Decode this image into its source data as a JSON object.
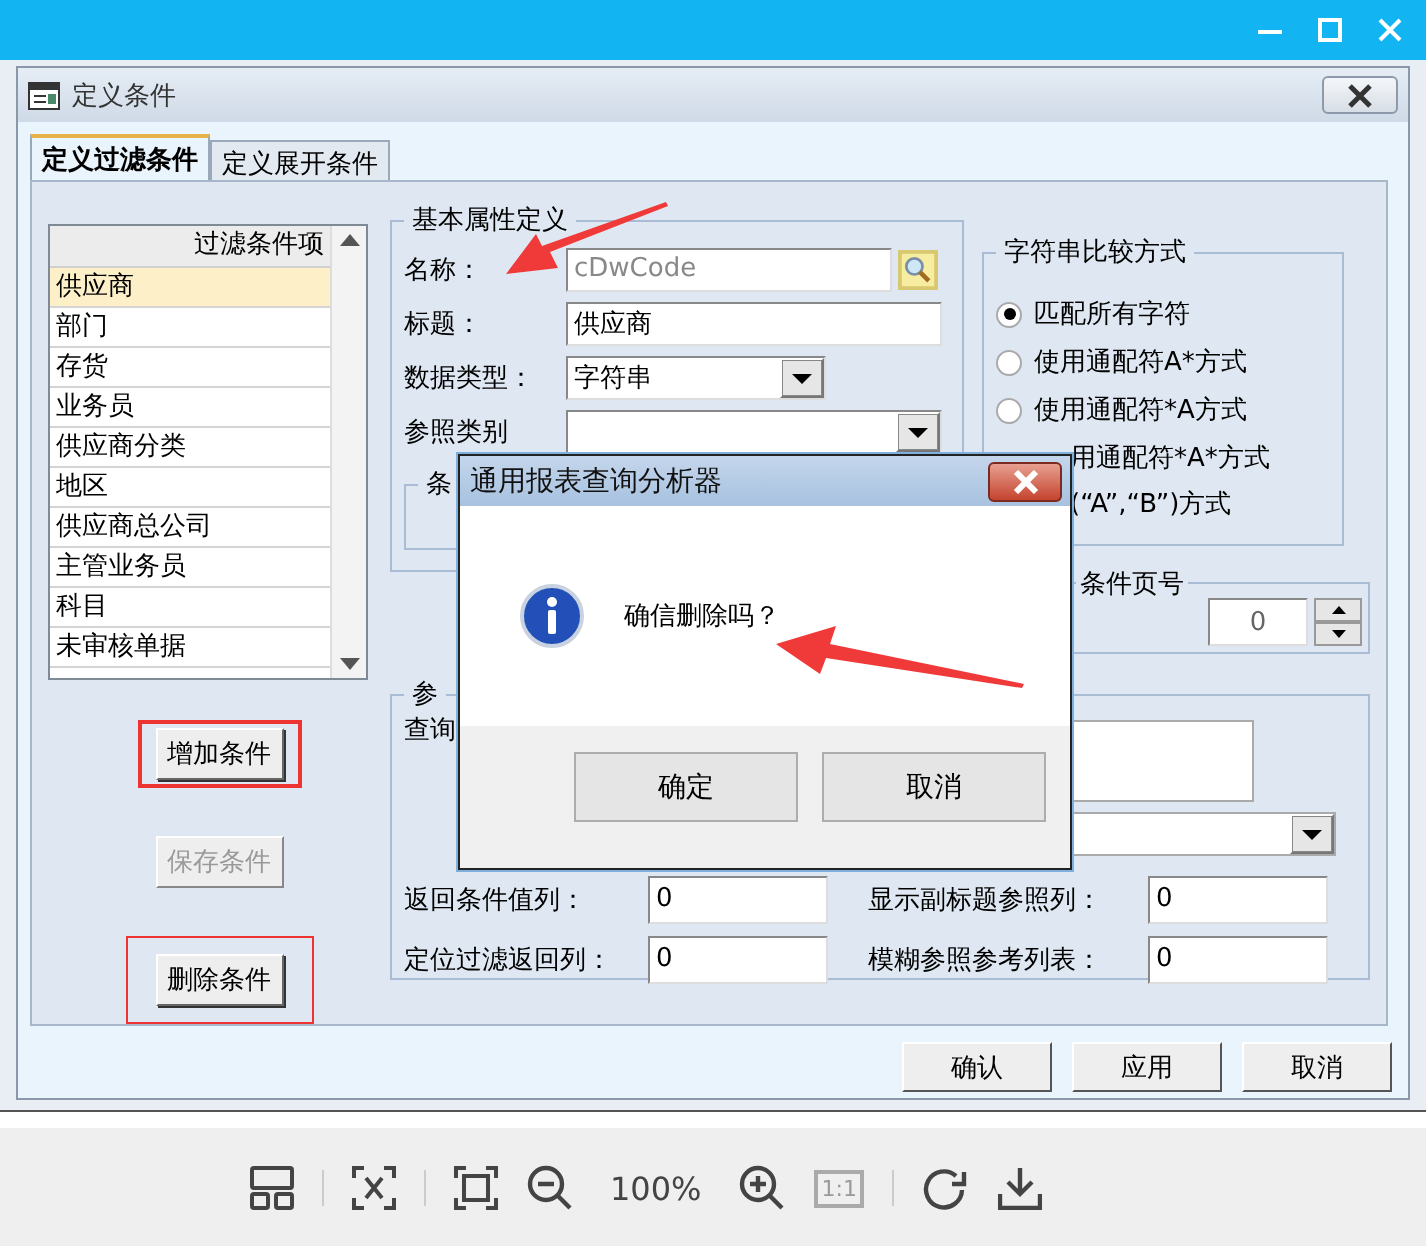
{
  "window": {
    "title": "定义条件"
  },
  "tabs": [
    {
      "label": "定义过滤条件",
      "selected": true
    },
    {
      "label": "定义展开条件",
      "selected": false
    }
  ],
  "filter_list": {
    "header": "过滤条件项",
    "items": [
      {
        "label": "供应商",
        "selected": true
      },
      {
        "label": "部门",
        "selected": false
      },
      {
        "label": "存货",
        "selected": false
      },
      {
        "label": "业务员",
        "selected": false
      },
      {
        "label": "供应商分类",
        "selected": false
      },
      {
        "label": "地区",
        "selected": false
      },
      {
        "label": "供应商总公司",
        "selected": false
      },
      {
        "label": "主管业务员",
        "selected": false
      },
      {
        "label": "科目",
        "selected": false
      },
      {
        "label": "未审核单据",
        "selected": false
      }
    ]
  },
  "list_buttons": [
    {
      "label": "增加条件",
      "disabled": false,
      "highlighted": true
    },
    {
      "label": "保存条件",
      "disabled": true,
      "highlighted": false
    },
    {
      "label": "删除条件",
      "disabled": false,
      "highlighted": true
    }
  ],
  "basic": {
    "title": "基本属性定义",
    "fields": [
      {
        "label": "名称：",
        "value": "cDwCode",
        "kind": "lookup",
        "disabled": true
      },
      {
        "label": "标题：",
        "value": "供应商",
        "kind": "text"
      },
      {
        "label": "数据类型：",
        "value": "字符串",
        "kind": "combo"
      },
      {
        "label": "参照类别",
        "kind": "combo"
      }
    ],
    "inner_group": "条"
  },
  "compare": {
    "title": "字符串比较方式",
    "options": [
      {
        "label": "匹配所有字符",
        "kind": "radio",
        "selected": true
      },
      {
        "label": "使用通配符A*方式",
        "kind": "radio",
        "selected": false
      },
      {
        "label": "使用通配符*A方式",
        "kind": "radio",
        "selected": false
      },
      {
        "label": "用通配符*A*方式",
        "kind": "covered"
      },
      {
        "label": "(“A”,“B”)方式",
        "kind": "covered"
      }
    ]
  },
  "page_no": {
    "label": "条件页号",
    "value": "0"
  },
  "reference": {
    "title": "参",
    "query_label": "查询",
    "fields": [
      {
        "label": "返回条件值列：",
        "value": "0"
      },
      {
        "label": "显示副标题参照列：",
        "value": "0"
      },
      {
        "label": "定位过滤返回列：",
        "value": "0"
      },
      {
        "label": "模糊参照参考列表：",
        "value": "0"
      }
    ]
  },
  "footer_buttons": [
    "确认",
    "应用",
    "取消"
  ],
  "message_box": {
    "title": "通用报表查询分析器",
    "message": "确信删除吗？",
    "buttons": [
      "确定",
      "取消"
    ]
  },
  "viewer_toolbar": {
    "zoom": "100%",
    "actual_size": "1:1",
    "actual_size_disabled": true
  }
}
